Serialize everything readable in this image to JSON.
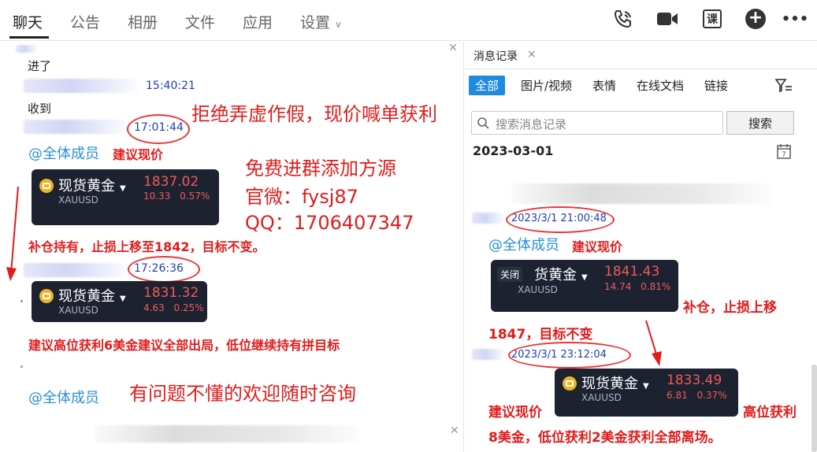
{
  "tabs": [
    {
      "label": "聊天",
      "active": true
    },
    {
      "label": "公告"
    },
    {
      "label": "相册"
    },
    {
      "label": "文件"
    },
    {
      "label": "应用"
    },
    {
      "label": "设置"
    }
  ],
  "toolbar_icons": [
    "voice-call-icon",
    "video-call-icon",
    "lesson-icon",
    "add-icon",
    "more-icon"
  ],
  "toolbar_lesson_label": "课",
  "toolbar_more_label": "•••",
  "chat": {
    "msg_jinle": "进了",
    "ts1": "15:40:21",
    "msg_shoudao": "收到",
    "ts2": "17:01:44",
    "mention1": "@全体成员",
    "advice1": "建议现价",
    "card1": {
      "name": "现货黄金",
      "code": "XAUUSD",
      "price": "1837.02",
      "change": "10.33 0.57%"
    },
    "note1": "补仓持有，止损上移至1842，目标不变。",
    "ts3": "17:26:36",
    "card2": {
      "name": "现货黄金",
      "code": "XAUUSD",
      "price": "1831.32",
      "change": "4.63 0.25%"
    },
    "note2": "建议高位获利6美金建议全部出局，低位继续持有拼目标",
    "mention2": "@全体成员",
    "overlay_top": "拒绝弄虚作假，现价喊单获利",
    "overlay_free": "免费进群添加方源",
    "overlay_wechat": "官微：fysj87",
    "overlay_qq": "QQ：1706407347",
    "overlay_bottom": "有问题不懂的欢迎随时咨询"
  },
  "panel": {
    "title": "消息记录",
    "close": "×",
    "filters": [
      "全部",
      "图片/视频",
      "表情",
      "在线文档",
      "链接"
    ],
    "search_placeholder": "搜索消息记录",
    "search_button": "搜索",
    "date": "2023-03-01",
    "ts1": "2023/3/1 21:00:48",
    "mention": "@全体成员",
    "advice": "建议现价",
    "card1": {
      "name": "货黄金",
      "close_badge": "关闭",
      "code": "XAUUSD",
      "price": "1841.43",
      "change": "14.74 0.81%"
    },
    "note1a": "补仓，止损上移",
    "note1b": "1847，目标不变",
    "ts2": "2023/3/1 23:12:04",
    "card2": {
      "name": "现货黄金",
      "code": "XAUUSD",
      "price": "1833.49",
      "change": "6.81 0.37%"
    },
    "advice2": "建议现价",
    "note2a": "高位获利",
    "note2b": "8美金，低位获利2美金获利全部离场。"
  },
  "colors": {
    "accent": "#1e8ae0",
    "red": "#e31b1b",
    "timestamp": "#1d3fb3",
    "mention": "#2a8fd6",
    "card_bg": "#1c2230"
  }
}
